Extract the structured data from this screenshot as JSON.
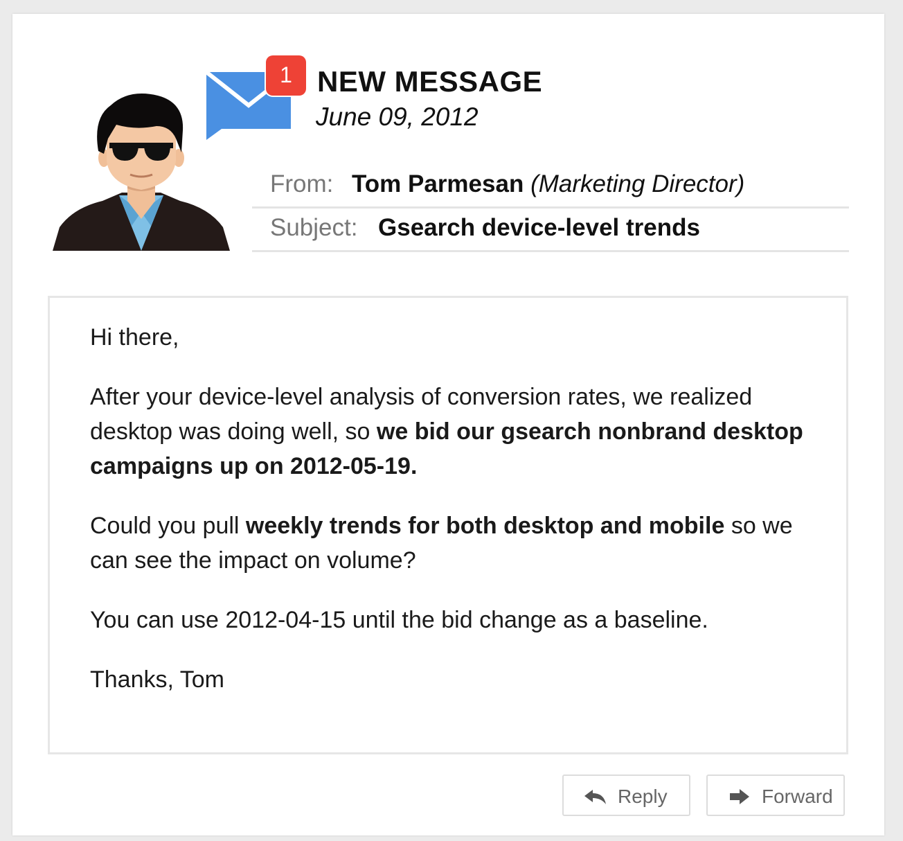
{
  "header": {
    "badge_count": "1",
    "title": "NEW MESSAGE",
    "date": "June 09, 2012"
  },
  "fields": {
    "from_label": "From:",
    "from_name": "Tom Parmesan",
    "from_role": "(Marketing Director)",
    "subject_label": "Subject:",
    "subject_value": "Gsearch device-level trends"
  },
  "body": {
    "greeting": "Hi there,",
    "p1_text": "After your device-level analysis of conversion rates, we realized desktop was doing well, so ",
    "p1_bold": "we bid our gsearch nonbrand desktop campaigns up on 2012-05-19.",
    "p2_text1": "Could you pull ",
    "p2_bold": "weekly trends for both desktop and mobile",
    "p2_text2": " so we can see the impact on volume?",
    "p3": "You can use 2012-04-15 until the bid change as a baseline.",
    "signoff": "Thanks, Tom"
  },
  "actions": {
    "reply_label": "Reply",
    "forward_label": "Forward"
  },
  "icons": {
    "mail": "envelope-chat-icon",
    "reply": "reply-arrow-icon",
    "forward": "forward-arrow-icon"
  },
  "colors": {
    "badge": "#ee4236",
    "envelope": "#4a90e2",
    "label_gray": "#777777"
  }
}
